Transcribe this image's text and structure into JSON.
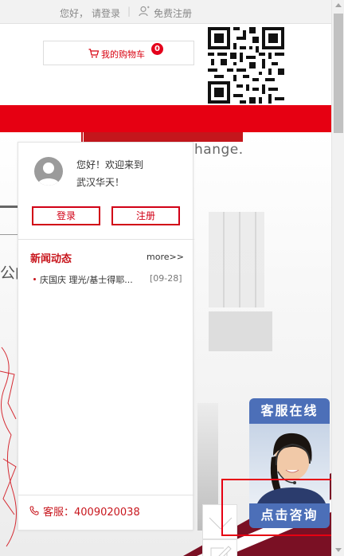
{
  "topbar": {
    "greeting": "您好，",
    "login_link": "请登录",
    "separator": "|",
    "register_link": "免费注册"
  },
  "header": {
    "cart_label": "我的购物车",
    "cart_count": "0",
    "qr_icon": "qr-code"
  },
  "banner": {
    "tagline": "hange.",
    "partial_text": "公的"
  },
  "user_panel": {
    "welcome_line1": "您好！欢迎来到",
    "welcome_line2": "武汉华天！",
    "login_button": "登录",
    "register_button": "注册",
    "news_title": "新闻动态",
    "more_label": "more>>",
    "news_items": [
      {
        "title": "庆国庆 理光/基士得耶...",
        "date": "[09-28]"
      }
    ],
    "service_phone": "客服：4009020038"
  },
  "customer_service": {
    "head_label": "客服在线",
    "button_label": "点击咨询"
  },
  "colors": {
    "brand_red": "#e60012",
    "text_red": "#c8161d",
    "cs_blue": "#4c6fb8"
  }
}
